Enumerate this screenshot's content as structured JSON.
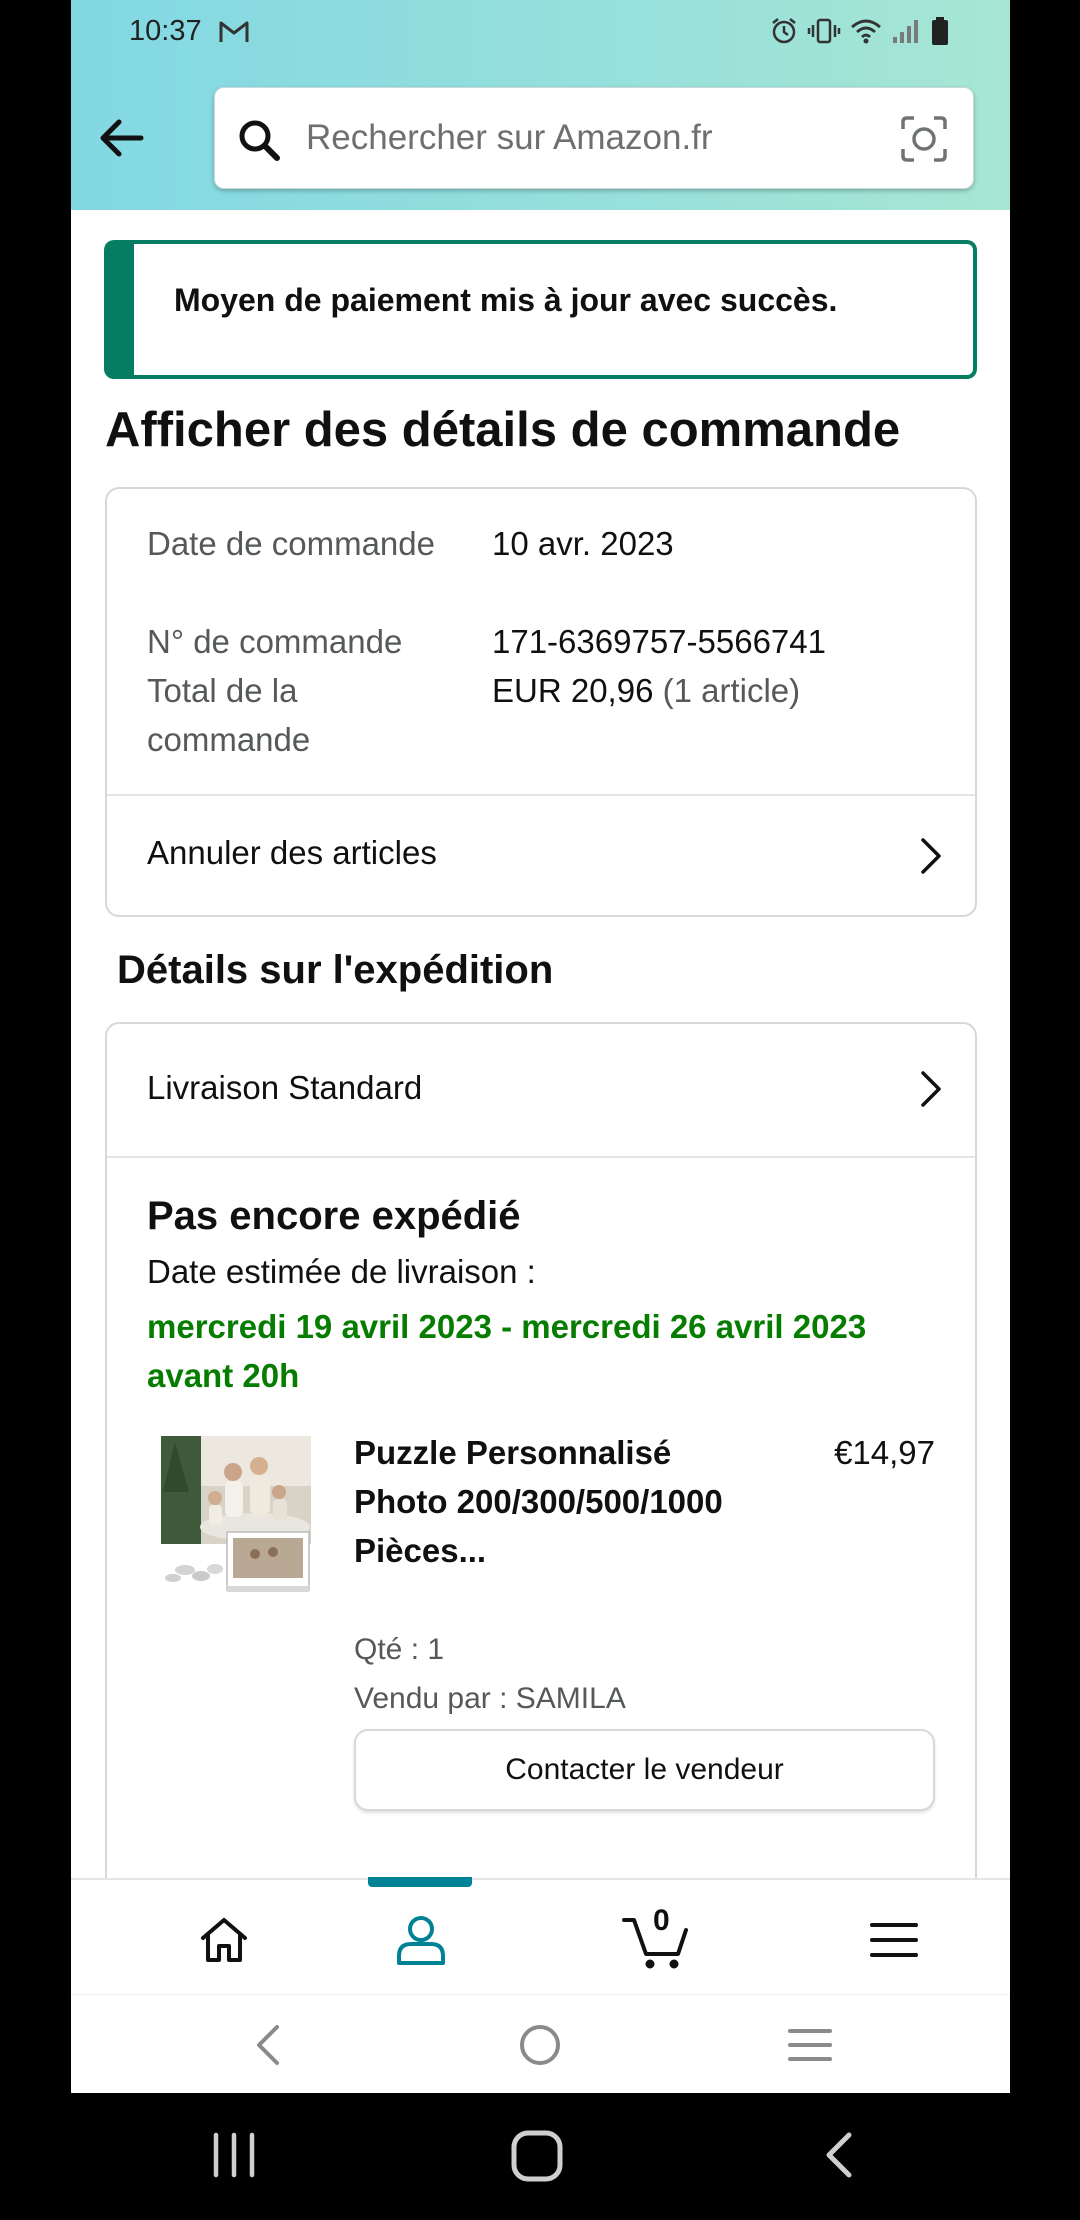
{
  "status_bar": {
    "time": "10:37",
    "icons": [
      "gmail-icon",
      "alarm-icon",
      "vibrate-icon",
      "wifi-icon",
      "signal-icon",
      "battery-icon"
    ]
  },
  "header": {
    "search": {
      "placeholder": "Rechercher sur Amazon.fr",
      "value": ""
    },
    "icons": [
      "back-arrow-icon",
      "search-icon",
      "camera-icon"
    ]
  },
  "alert": {
    "message": "Moyen de paiement mis à jour avec succès.",
    "color": "#067d62"
  },
  "page_title": "Afficher des détails de commande",
  "order_summary": {
    "date_label": "Date de commande",
    "date_value": "10 avr. 2023",
    "number_label": "N° de commande",
    "number_value": "171-6369757-5566741",
    "total_label": "Total de la commande",
    "total_value": "EUR 20,96",
    "total_count": "(1 article)",
    "cancel_label": "Annuler des articles"
  },
  "shipping": {
    "section_title": "Détails sur l'expédition",
    "delivery_method": "Livraison Standard",
    "status": "Pas encore expédié",
    "estimate_label": "Date estimée de livraison :",
    "estimate_value": "mercredi 19 avril 2023 - mercredi 26 avril 2023 avant 20h",
    "estimate_color": "#067d00",
    "item": {
      "title": "Puzzle Personnalisé Photo 200/300/500/1000 Pièces...",
      "price": "€14,97",
      "qty": "Qté : 1",
      "seller": "Vendu par : SAMILA",
      "contact_button": "Contacter le vendeur"
    }
  },
  "tab_bar": {
    "tabs": [
      "home-icon",
      "account-icon",
      "cart-icon",
      "menu-icon"
    ],
    "active": "account-icon",
    "cart_count": "0",
    "accent": "#008296"
  },
  "nav_bar": {
    "buttons": [
      "back",
      "home",
      "recents"
    ]
  }
}
